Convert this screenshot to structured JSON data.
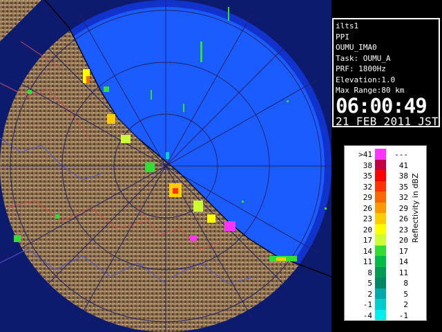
{
  "info": {
    "site": "ilts1",
    "mode": "PPI",
    "product": "OUMU_IMA0",
    "task": "Task: OUMU_A",
    "prf": "PRF: 1800Hz",
    "elevation": "Elevation:1.0",
    "max_range": "Max Range:80 km",
    "time": "06:00:49",
    "date": "21 FEB 2011 JST"
  },
  "legend": {
    "title": "Reflectivity in dBZ",
    "rows": [
      {
        "lo": ">41",
        "hi": "---",
        "color": "#ff33ff"
      },
      {
        "lo": "38",
        "hi": "41",
        "color": "#c00040"
      },
      {
        "lo": "35",
        "hi": "38",
        "color": "#ff0000"
      },
      {
        "lo": "32",
        "hi": "35",
        "color": "#ff3300"
      },
      {
        "lo": "29",
        "hi": "32",
        "color": "#ff6600"
      },
      {
        "lo": "26",
        "hi": "29",
        "color": "#ff9900"
      },
      {
        "lo": "23",
        "hi": "26",
        "color": "#ffcc00"
      },
      {
        "lo": "20",
        "hi": "23",
        "color": "#ffff00"
      },
      {
        "lo": "17",
        "hi": "20",
        "color": "#ccff33"
      },
      {
        "lo": "14",
        "hi": "17",
        "color": "#33dd33"
      },
      {
        "lo": "11",
        "hi": "14",
        "color": "#00bb44"
      },
      {
        "lo": "8",
        "hi": "11",
        "color": "#009955"
      },
      {
        "lo": "5",
        "hi": "8",
        "color": "#008866"
      },
      {
        "lo": "2",
        "hi": "5",
        "color": "#00aaaa"
      },
      {
        "lo": "-1",
        "hi": "2",
        "color": "#00cccc"
      },
      {
        "lo": "-4",
        "hi": "-1",
        "color": "#00eeee"
      }
    ]
  },
  "colors": {
    "sea_inner": "#1a5cff",
    "sea_outer": "#1133cc",
    "land": "#8a6e4e",
    "range_ring": "#222266",
    "coast": "#000000"
  }
}
